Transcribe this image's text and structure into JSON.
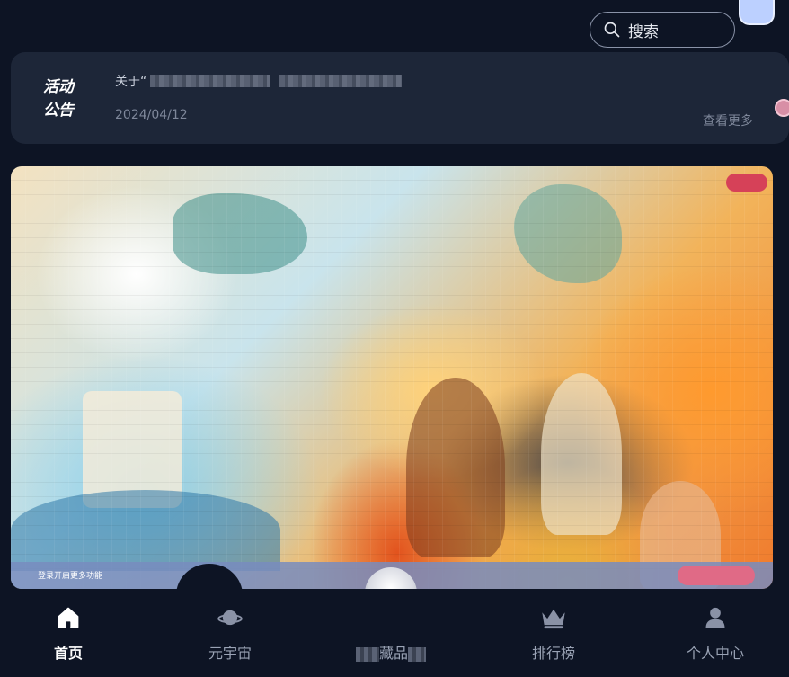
{
  "header": {
    "search_label": "搜索"
  },
  "notice": {
    "tag_line1": "活动",
    "tag_line2": "公告",
    "title_prefix": "关于“",
    "date": "2024/04/12",
    "more_label": "查看更多"
  },
  "banner": {
    "strip_text": "登录开启更多功能"
  },
  "tabbar": {
    "items": [
      {
        "label": "首页",
        "icon": "home-icon",
        "active": true
      },
      {
        "label": "元宇宙",
        "icon": "planet-icon",
        "active": false
      },
      {
        "label": "藏品",
        "icon": "collection-icon",
        "active": false
      },
      {
        "label": "排行榜",
        "icon": "crown-icon",
        "active": false
      },
      {
        "label": "个人中心",
        "icon": "user-icon",
        "active": false
      }
    ]
  },
  "colors": {
    "background": "#0d1424",
    "card": "#1d2638",
    "muted_text": "#7e879a",
    "accent_pink": "#d64158"
  }
}
